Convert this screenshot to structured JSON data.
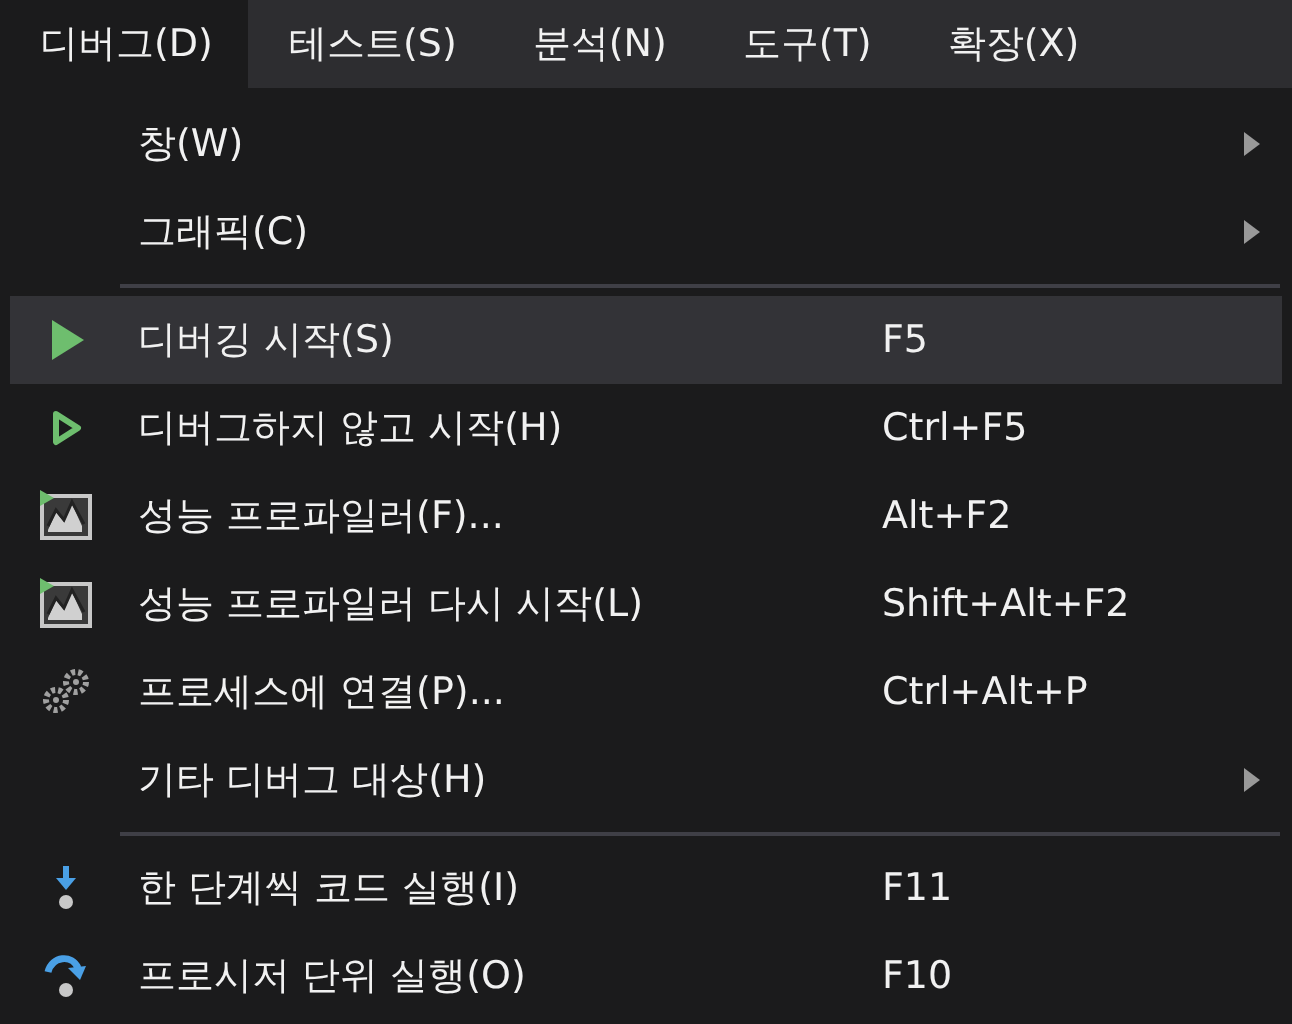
{
  "menubar": [
    {
      "label": "디버그(D)",
      "selected": true
    },
    {
      "label": "테스트(S)",
      "selected": false
    },
    {
      "label": "분석(N)",
      "selected": false
    },
    {
      "label": "도구(T)",
      "selected": false
    },
    {
      "label": "확장(X)",
      "selected": false
    }
  ],
  "menu": [
    {
      "kind": "plain",
      "label": "창(W)",
      "submenu": true,
      "selected": false
    },
    {
      "kind": "plain",
      "label": "그래픽(C)",
      "submenu": true,
      "selected": false
    },
    {
      "kind": "separator"
    },
    {
      "kind": "play",
      "label": "디버깅 시작(S)",
      "shortcut": "F5",
      "submenu": false,
      "selected": true
    },
    {
      "kind": "outline",
      "label": "디버그하지 않고 시작(H)",
      "shortcut": "Ctrl+F5",
      "submenu": false,
      "selected": false
    },
    {
      "kind": "profiler",
      "label": "성능 프로파일러(F)...",
      "shortcut": "Alt+F2",
      "submenu": false,
      "selected": false
    },
    {
      "kind": "profiler",
      "label": "성능 프로파일러 다시 시작(L)",
      "shortcut": "Shift+Alt+F2",
      "submenu": false,
      "selected": false
    },
    {
      "kind": "gears",
      "label": "프로세스에 연결(P)...",
      "shortcut": "Ctrl+Alt+P",
      "submenu": false,
      "selected": false
    },
    {
      "kind": "plain",
      "label": "기타 디버그 대상(H)",
      "submenu": true,
      "selected": false
    },
    {
      "kind": "separator"
    },
    {
      "kind": "stepinto",
      "label": "한 단계씩 코드 실행(I)",
      "shortcut": "F11",
      "submenu": false,
      "selected": false
    },
    {
      "kind": "stepover",
      "label": "프로시저 단위 실행(O)",
      "shortcut": "F10",
      "submenu": false,
      "selected": false
    }
  ]
}
